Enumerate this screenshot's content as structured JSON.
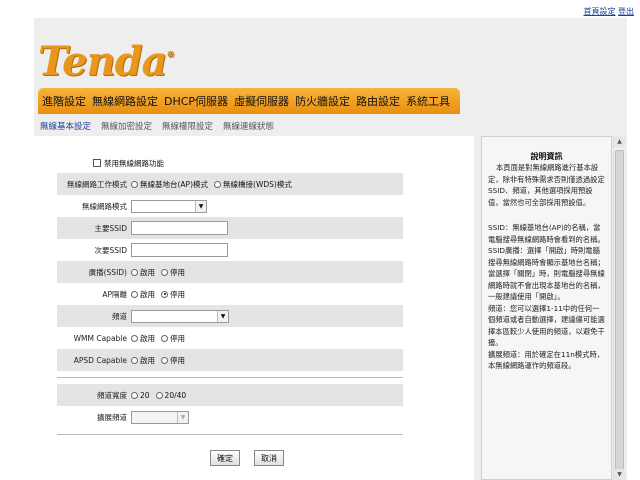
{
  "header": {
    "links": [
      "首頁設定",
      "登出"
    ],
    "logo_text": "Tenda"
  },
  "main_nav": {
    "items": [
      "進階設定",
      "無線網路設定",
      "DHCP伺服器",
      "虛擬伺服器",
      "防火牆設定",
      "路由設定",
      "系統工具"
    ],
    "active": "無線網路設定"
  },
  "sub_nav": {
    "items": [
      "無線基本設定",
      "無線加密設定",
      "無線權限設定",
      "無線連線狀態"
    ],
    "active": "無線基本設定"
  },
  "form": {
    "disable_wireless": {
      "label": "禁用無線網路功能",
      "checked": false
    },
    "work_mode": {
      "label": "無線網路工作模式",
      "options": [
        "無線基地台(AP)模式",
        "無線橋接(WDS)模式"
      ]
    },
    "network_mode": {
      "label": "無線網路模式",
      "value": ""
    },
    "primary_ssid": {
      "label": "主要SSID",
      "value": ""
    },
    "secondary_ssid": {
      "label": "次要SSID",
      "value": ""
    },
    "broadcast_ssid": {
      "label": "廣播(SSID)",
      "options": [
        "啟用",
        "停用"
      ]
    },
    "ap_isolation": {
      "label": "AP隔離",
      "options": [
        "啟用",
        "停用"
      ],
      "selected": "停用"
    },
    "channel": {
      "label": "頻道",
      "value": ""
    },
    "wmm": {
      "label": "WMM Capable",
      "options": [
        "啟用",
        "停用"
      ]
    },
    "apsd": {
      "label": "APSD Capable",
      "options": [
        "啟用",
        "停用"
      ]
    },
    "channel_width": {
      "label": "頻道寬度",
      "options": [
        "20",
        "20/40"
      ]
    },
    "ext_channel": {
      "label": "擴展頻道",
      "value": ""
    },
    "ok_label": "確定",
    "cancel_label": "取消"
  },
  "help": {
    "title": "說明資訊",
    "paragraphs": [
      "本頁面是對無線網路進行基本設定，除非有特殊需求否則僅透過設定SSID、頻道，其他選項採用預設值，當然也可全部採用預設值。",
      "SSID：無線基地台(AP)的名稱，當電腦搜尋無線網路時會看到的名稱。",
      "SSID廣播：選擇「開啟」時則電腦搜尋無線網路時會顯示基地台名稱；當選擇「關閉」時，則電腦搜尋無線網路時就不會出現本基地台的名稱，一般建議使用「開啟」。",
      "頻道：您可以選擇1-11中的任何一個頻道或者自動選擇，建議儘可能選擇本區較少人使用的頻道，以避免干擾。",
      "擴展頻道：用於確定在11n模式時，本無線網路運作的頻道段。"
    ]
  }
}
